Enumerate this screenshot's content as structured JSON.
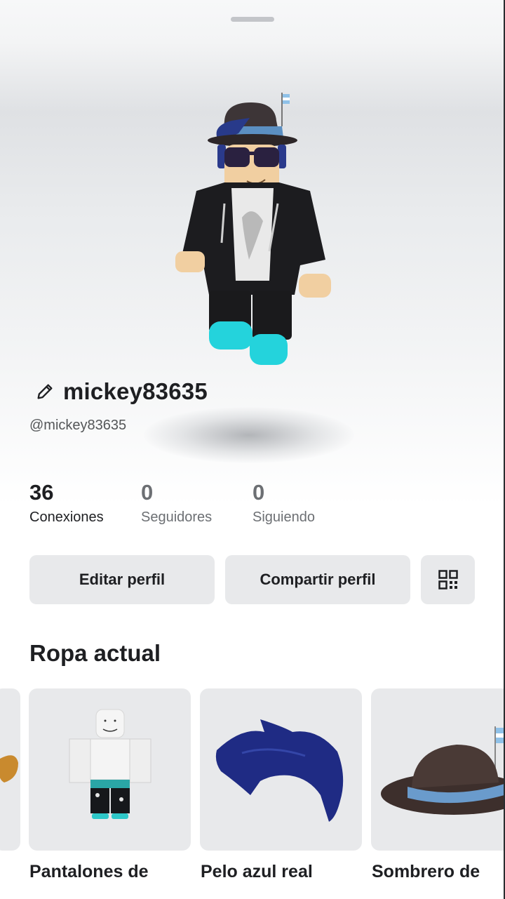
{
  "profile": {
    "display_name": "mickey83635",
    "username": "@mickey83635"
  },
  "stats": [
    {
      "value": "36",
      "label": "Conexiones"
    },
    {
      "value": "0",
      "label": "Seguidores"
    },
    {
      "value": "0",
      "label": "Siguiendo"
    }
  ],
  "actions": {
    "edit_label": "Editar perfil",
    "share_label": "Compartir perfil",
    "qr_icon": "qr-code-icon"
  },
  "outfit": {
    "title": "Ropa actual",
    "items": [
      {
        "name": "Pantalones de"
      },
      {
        "name": "Pelo azul real"
      },
      {
        "name": "Sombrero de"
      }
    ]
  },
  "colors": {
    "text_primary": "#1e1f22",
    "text_muted": "#6c6f73",
    "button_bg": "#e8e9eb"
  }
}
